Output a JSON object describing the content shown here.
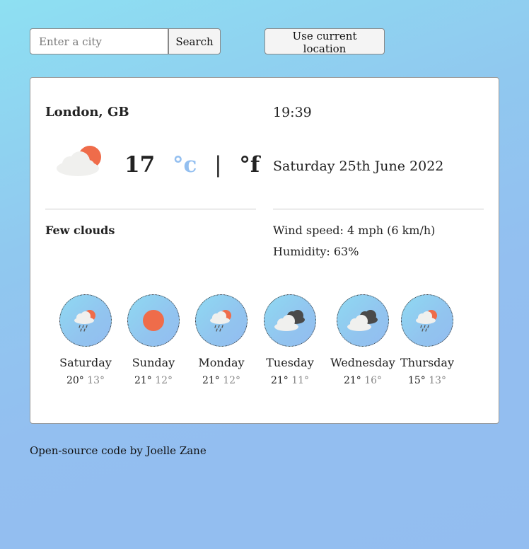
{
  "search": {
    "placeholder": "Enter a city",
    "button_label": "Search"
  },
  "location_button_label": "Use current location",
  "current": {
    "city": "London, GB",
    "time": "19:39",
    "temperature": "17",
    "unit_c": "°c",
    "separator": "|",
    "unit_f": "°f",
    "date": "Saturday 25th June 2022",
    "description": "Few clouds",
    "wind": "Wind speed: 4 mph (6 km/h)",
    "humidity": "Humidity: 63%",
    "icon": "few-clouds-icon"
  },
  "forecast": [
    {
      "day": "Saturday",
      "high": "20°",
      "low": "13°",
      "icon": "rain-sun-icon"
    },
    {
      "day": "Sunday",
      "high": "21°",
      "low": "12°",
      "icon": "sun-icon"
    },
    {
      "day": "Monday",
      "high": "21°",
      "low": "12°",
      "icon": "rain-sun-icon"
    },
    {
      "day": "Tuesday",
      "high": "21°",
      "low": "11°",
      "icon": "broken-clouds-icon"
    },
    {
      "day": "Wednesday",
      "high": "21°",
      "low": "16°",
      "icon": "broken-clouds-icon"
    },
    {
      "day": "Thursday",
      "high": "15°",
      "low": "13°",
      "icon": "rain-sun-icon"
    }
  ],
  "footer": {
    "link_text": "Open-source code",
    "middle": " by ",
    "author": "Joelle Zane"
  },
  "colors": {
    "sun": "#ef6c4a",
    "cloud": "#f0f0ee",
    "dark_cloud": "#4a4a4a",
    "accent_unit": "#93bff0"
  }
}
